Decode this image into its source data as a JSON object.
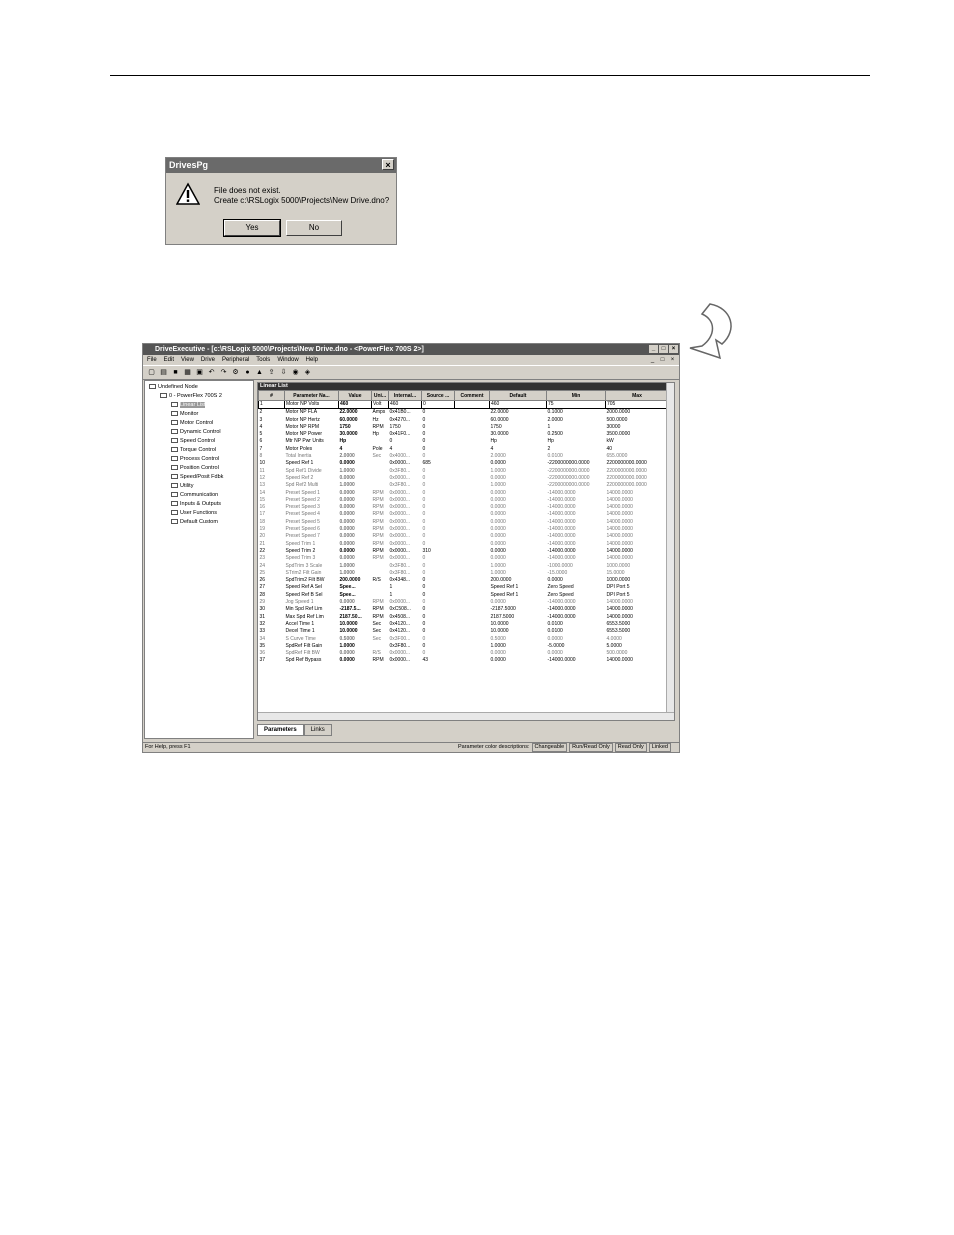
{
  "dialog": {
    "title": "DrivesPg",
    "close": "×",
    "message_line1": "File does not exist.",
    "message_line2": "Create c:\\RSLogix 5000\\Projects\\New Drive.dno?",
    "yes": "Yes",
    "no": "No"
  },
  "app": {
    "title": "DriveExecutive - [c:\\RSLogix 5000\\Projects\\New Drive.dno - <PowerFlex 700S 2>]",
    "window_buttons": [
      "_",
      "□",
      "×"
    ],
    "mdi_buttons": [
      "_",
      "□",
      "×"
    ],
    "menu": [
      "File",
      "Edit",
      "View",
      "Drive",
      "Peripheral",
      "Tools",
      "Window",
      "Help"
    ],
    "tree": [
      {
        "label": "Undefined Node",
        "indent": 0
      },
      {
        "label": "0 - PowerFlex 700S 2",
        "indent": 1
      },
      {
        "label": "Linear List",
        "indent": 2,
        "selected": true
      },
      {
        "label": "Monitor",
        "indent": 2
      },
      {
        "label": "Motor Control",
        "indent": 2
      },
      {
        "label": "Dynamic Control",
        "indent": 2
      },
      {
        "label": "Speed Control",
        "indent": 2
      },
      {
        "label": "Torque Control",
        "indent": 2
      },
      {
        "label": "Process Control",
        "indent": 2
      },
      {
        "label": "Position Control",
        "indent": 2
      },
      {
        "label": "Speed/Posit Fdbk",
        "indent": 2
      },
      {
        "label": "Utility",
        "indent": 2
      },
      {
        "label": "Communication",
        "indent": 2
      },
      {
        "label": "Inputs & Outputs",
        "indent": 2
      },
      {
        "label": "User Functions",
        "indent": 2
      },
      {
        "label": "Default Custom",
        "indent": 2
      }
    ],
    "grid_title": "Linear List",
    "columns": [
      "#",
      "Parameter Na...",
      "Value",
      "Uni...",
      "Internal...",
      "Source ...",
      "Comment",
      "Default",
      "Min",
      "Max"
    ],
    "rows": [
      [
        "1",
        "Motor NP Volts",
        "460",
        "Volt",
        "460",
        "0",
        "",
        "460",
        "75",
        "705"
      ],
      [
        "2",
        "Motor NP FLA",
        "22.0000",
        "Amps",
        "0x41B0...",
        "0",
        "",
        "22.0000",
        "0.1000",
        "2000.0000"
      ],
      [
        "3",
        "Motor NP Hertz",
        "60.0000",
        "Hz",
        "0x4270...",
        "0",
        "",
        "60.0000",
        "2.0000",
        "500.0000"
      ],
      [
        "4",
        "Motor NP RPM",
        "1750",
        "RPM",
        "1750",
        "0",
        "",
        "1750",
        "1",
        "30000"
      ],
      [
        "5",
        "Motor NP Power",
        "30.0000",
        "Hp",
        "0x41F0...",
        "0",
        "",
        "30.0000",
        "0.2500",
        "3500.0000"
      ],
      [
        "6",
        "Mtr NP Pwr Units",
        "Hp",
        "",
        "0",
        "0",
        "",
        "Hp",
        "Hp",
        "kW"
      ],
      [
        "7",
        "Motor Poles",
        "4",
        "Pole",
        "4",
        "0",
        "",
        "4",
        "2",
        "40"
      ],
      [
        "8",
        "Total Inertia",
        "2.0000",
        "Sec",
        "0x4000...",
        "0",
        "",
        "2.0000",
        "0.0100",
        "655.0000"
      ],
      [
        "10",
        "Speed Ref 1",
        "0.0000",
        "",
        "0x0000...",
        "685",
        "",
        "0.0000",
        "-2200000000.0000",
        "2200000000.0000"
      ],
      [
        "11",
        "Spd Ref1 Divide",
        "1.0000",
        "",
        "0x3F80...",
        "0",
        "",
        "1.0000",
        "-2200000000.0000",
        "2200000000.0000"
      ],
      [
        "12",
        "Speed Ref 2",
        "0.0000",
        "",
        "0x0000...",
        "0",
        "",
        "0.0000",
        "-2200000000.0000",
        "2200000000.0000"
      ],
      [
        "13",
        "Spd Ref2 Multi",
        "1.0000",
        "",
        "0x3F80...",
        "0",
        "",
        "1.0000",
        "-2200000000.0000",
        "2200000000.0000"
      ],
      [
        "14",
        "Preset Speed 1",
        "0.0000",
        "RPM",
        "0x0000...",
        "0",
        "",
        "0.0000",
        "-14000.0000",
        "14000.0000"
      ],
      [
        "15",
        "Preset Speed 2",
        "0.0000",
        "RPM",
        "0x0000...",
        "0",
        "",
        "0.0000",
        "-14000.0000",
        "14000.0000"
      ],
      [
        "16",
        "Preset Speed 3",
        "0.0000",
        "RPM",
        "0x0000...",
        "0",
        "",
        "0.0000",
        "-14000.0000",
        "14000.0000"
      ],
      [
        "17",
        "Preset Speed 4",
        "0.0000",
        "RPM",
        "0x0000...",
        "0",
        "",
        "0.0000",
        "-14000.0000",
        "14000.0000"
      ],
      [
        "18",
        "Preset Speed 5",
        "0.0000",
        "RPM",
        "0x0000...",
        "0",
        "",
        "0.0000",
        "-14000.0000",
        "14000.0000"
      ],
      [
        "19",
        "Preset Speed 6",
        "0.0000",
        "RPM",
        "0x0000...",
        "0",
        "",
        "0.0000",
        "-14000.0000",
        "14000.0000"
      ],
      [
        "20",
        "Preset Speed 7",
        "0.0000",
        "RPM",
        "0x0000...",
        "0",
        "",
        "0.0000",
        "-14000.0000",
        "14000.0000"
      ],
      [
        "21",
        "Speed Trim 1",
        "0.0000",
        "RPM",
        "0x0000...",
        "0",
        "",
        "0.0000",
        "-14000.0000",
        "14000.0000"
      ],
      [
        "22",
        "Speed Trim 2",
        "0.0000",
        "RPM",
        "0x0000...",
        "310",
        "",
        "0.0000",
        "-14000.0000",
        "14000.0000"
      ],
      [
        "23",
        "Speed Trim 3",
        "0.0000",
        "RPM",
        "0x0000...",
        "0",
        "",
        "0.0000",
        "-14000.0000",
        "14000.0000"
      ],
      [
        "24",
        "SpdTrim 3 Scale",
        "1.0000",
        "",
        "0x3F80...",
        "0",
        "",
        "1.0000",
        "-1000.0000",
        "1000.0000"
      ],
      [
        "25",
        "STrim2 Filt Gain",
        "1.0000",
        "",
        "0x3F80...",
        "0",
        "",
        "1.0000",
        "-15.0000",
        "15.0000"
      ],
      [
        "26",
        "SpdTrim2 Filt BW",
        "200.0000",
        "R/S",
        "0x4348...",
        "0",
        "",
        "200.0000",
        "0.0000",
        "1000.0000"
      ],
      [
        "27",
        "Speed Ref A Sel",
        "Spee...",
        "",
        "1",
        "0",
        "",
        "Speed Ref 1",
        "Zero Speed",
        "DPI Port 5"
      ],
      [
        "28",
        "Speed Ref B Sel",
        "Spee...",
        "",
        "1",
        "0",
        "",
        "Speed Ref 1",
        "Zero Speed",
        "DPI Port 5"
      ],
      [
        "29",
        "Jog Speed 1",
        "0.0000",
        "RPM",
        "0x0000...",
        "0",
        "",
        "0.0000",
        "-14000.0000",
        "14000.0000"
      ],
      [
        "30",
        "Min Spd Ref Lim",
        "-2187.5...",
        "RPM",
        "0xC508...",
        "0",
        "",
        "-2187.5000",
        "-14000.0000",
        "14000.0000"
      ],
      [
        "31",
        "Max Spd Ref Lim",
        "2187.50...",
        "RPM",
        "0x4508...",
        "0",
        "",
        "2187.5000",
        "-14000.0000",
        "14000.0000"
      ],
      [
        "32",
        "Accel Time 1",
        "10.0000",
        "Sec",
        "0x4120...",
        "0",
        "",
        "10.0000",
        "0.0100",
        "6553.5000"
      ],
      [
        "33",
        "Decel Time 1",
        "10.0000",
        "Sec",
        "0x4120...",
        "0",
        "",
        "10.0000",
        "0.0100",
        "6553.5000"
      ],
      [
        "34",
        "S Curve Time",
        "0.5000",
        "Sec",
        "0x3F00...",
        "0",
        "",
        "0.5000",
        "0.0000",
        "4.0000"
      ],
      [
        "35",
        "SpdRef Filt Gain",
        "1.0000",
        "",
        "0x3F80...",
        "0",
        "",
        "1.0000",
        "-5.0000",
        "5.0000"
      ],
      [
        "36",
        "SpdRef Filt BW",
        "0.0000",
        "R/S",
        "0x0000...",
        "0",
        "",
        "0.0000",
        "0.0000",
        "500.0000"
      ],
      [
        "37",
        "Spd Ref Bypass",
        "0.0000",
        "RPM",
        "0x0000...",
        "43",
        "",
        "0.0000",
        "-14000.0000",
        "14000.0000"
      ]
    ],
    "tabs": [
      "Parameters",
      "Links"
    ],
    "status_left": "For Help, press F1",
    "status_label": "Parameter color descriptions:",
    "status_legend": [
      "Changeable",
      "Run/Read Only",
      "Read Only",
      "Linked"
    ]
  }
}
